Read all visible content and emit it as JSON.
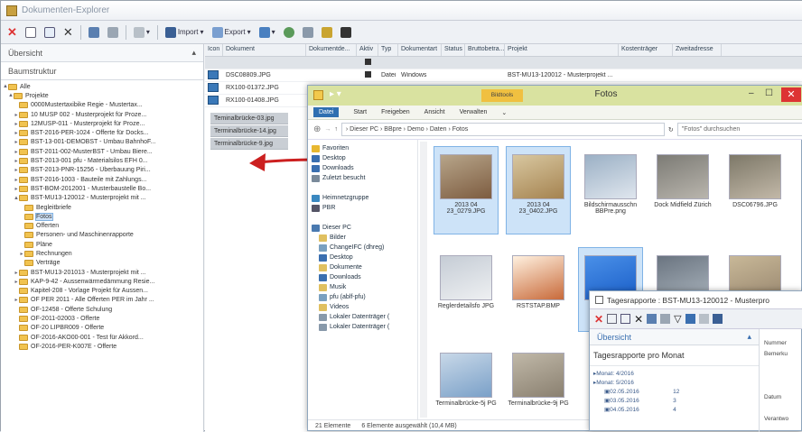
{
  "app": {
    "title": "Dokumenten-Explorer"
  },
  "toolbar": {
    "import_label": "Import",
    "export_label": "Export"
  },
  "left": {
    "overview": "Übersicht",
    "structure": "Baumstruktur",
    "tree": [
      {
        "label": "Alle",
        "ind": 0,
        "tw": "▲"
      },
      {
        "label": "Projekte",
        "ind": 1,
        "tw": "▲"
      },
      {
        "label": "0000Mustertaxibike Regie - Mustertax...",
        "ind": 2,
        "tw": ""
      },
      {
        "label": "10 MUSP 002 - Musterprojekt für Proze...",
        "ind": 2,
        "tw": "▸"
      },
      {
        "label": "12MUSP-011 - Musterprojekt für Proze...",
        "ind": 2,
        "tw": "▸"
      },
      {
        "label": "BST-2016-PER-1024 - Offerte für Docks...",
        "ind": 2,
        "tw": "▸"
      },
      {
        "label": "BST-13-001-DEMOBST - Umbau BahnhoF...",
        "ind": 2,
        "tw": "▸"
      },
      {
        "label": "BST-2011-002-MusterBST - Umbau Biere...",
        "ind": 2,
        "tw": "▸"
      },
      {
        "label": "BST-2013-001 pfu - Materialsilos EFH 0...",
        "ind": 2,
        "tw": "▸"
      },
      {
        "label": "BST-2013-PNR-15256 - Überbauung Piri...",
        "ind": 2,
        "tw": "▸"
      },
      {
        "label": "BST-2016-1003 - Bauteile mit Zahlungs...",
        "ind": 2,
        "tw": "▸"
      },
      {
        "label": "BST-BOM-2012001 - Musterbaustelle Bo...",
        "ind": 2,
        "tw": "▸"
      },
      {
        "label": "BST-MU13-120012 - Musterprojekt mit ...",
        "ind": 2,
        "tw": "▲"
      },
      {
        "label": "Begleitbriefe",
        "ind": 3,
        "tw": ""
      },
      {
        "label": "Fotos",
        "ind": 3,
        "tw": "",
        "sel": true
      },
      {
        "label": "Offerten",
        "ind": 3,
        "tw": ""
      },
      {
        "label": "Personen- und Maschinenrapporte",
        "ind": 3,
        "tw": ""
      },
      {
        "label": "Pläne",
        "ind": 3,
        "tw": ""
      },
      {
        "label": "Rechnungen",
        "ind": 3,
        "tw": "▸"
      },
      {
        "label": "Verträge",
        "ind": 3,
        "tw": ""
      },
      {
        "label": "BST-MU13-201013 - Musterprojekt mit ...",
        "ind": 2,
        "tw": "▸"
      },
      {
        "label": "KAP-9-42 - Aussenwärmedämmung Resie...",
        "ind": 2,
        "tw": "▸"
      },
      {
        "label": "Kapitel-208 - Vorlage Projekt für Aussen...",
        "ind": 2,
        "tw": ""
      },
      {
        "label": "OF PER 2011 - Alle Offerten PER im Jahr ...",
        "ind": 2,
        "tw": "▸"
      },
      {
        "label": "OF-12458 - Offerte Schulung",
        "ind": 2,
        "tw": ""
      },
      {
        "label": "OF-2011-02003 - Offerte",
        "ind": 2,
        "tw": ""
      },
      {
        "label": "OF-20 LIPBR009 - Offerte",
        "ind": 2,
        "tw": ""
      },
      {
        "label": "OF-2016-AKO00-001 - Test für Akkord...",
        "ind": 2,
        "tw": ""
      },
      {
        "label": "OF-2016-PER-K007E - Offerte",
        "ind": 2,
        "tw": ""
      }
    ]
  },
  "grid": {
    "columns": [
      "Icon",
      "Dokument",
      "Dokumentde...",
      "Aktiv",
      "Typ",
      "Dokumentart",
      "Status",
      "Bruttobetra...",
      "Projekt",
      "Kostenträger",
      "Zweitadresse"
    ],
    "rows": [
      {
        "name": "",
        "aktiv": true,
        "typ": "",
        "art": "",
        "projekt": ""
      },
      {
        "name": "DSC08809.JPG",
        "aktiv": true,
        "typ": "Datei",
        "art": "Windows",
        "projekt": "BST-MU13-120012 - Musterprojekt ..."
      },
      {
        "name": "RX100-01372.JPG",
        "aktiv": false,
        "typ": "",
        "art": "",
        "projekt": ""
      },
      {
        "name": "RX100-01408.JPG",
        "aktiv": false,
        "typ": "",
        "art": "",
        "projekt": ""
      }
    ],
    "drag": [
      "Teminalbrücke-03.jpg",
      "Terminalbrücke-14.jpg",
      "Terminalbrücke-9.jpg"
    ]
  },
  "explorer": {
    "context_tab": "Bildtools",
    "title": "Fotos",
    "ribbon": [
      "Datei",
      "Start",
      "Freigeben",
      "Ansicht",
      "Verwalten"
    ],
    "path": [
      "Dieser PC",
      "BBpre",
      "Demo",
      "Daten",
      "Fotos"
    ],
    "search_placeholder": "\"Fotos\" durchsuchen",
    "nav": [
      {
        "label": "Favoriten",
        "color": "#e8b830"
      },
      {
        "label": "Desktop",
        "color": "#3a6fb0"
      },
      {
        "label": "Downloads",
        "color": "#3a6fb0"
      },
      {
        "label": "Zuletzt besucht",
        "color": "#7a8a9a"
      },
      {
        "label": "",
        "color": ""
      },
      {
        "label": "Heimnetzgruppe",
        "color": "#3a88c0"
      },
      {
        "label": "PBR",
        "color": "#556"
      },
      {
        "label": "",
        "color": ""
      },
      {
        "label": "Dieser PC",
        "color": "#4a7ab0"
      },
      {
        "label": "Bilder",
        "color": "#e0c060"
      },
      {
        "label": "ChangeIFC (dhreg)",
        "color": "#7aa0c0"
      },
      {
        "label": "Desktop",
        "color": "#3a6fb0"
      },
      {
        "label": "Dokumente",
        "color": "#e0c060"
      },
      {
        "label": "Downloads",
        "color": "#3a6fb0"
      },
      {
        "label": "Musik",
        "color": "#e0c060"
      },
      {
        "label": "pfu (ablf-pfu)",
        "color": "#7aa0c0"
      },
      {
        "label": "Videos",
        "color": "#e0c060"
      },
      {
        "label": "Lokaler Datenträger (",
        "color": "#8899aa"
      },
      {
        "label": "Lokaler Datenträger (",
        "color": "#8899aa"
      }
    ],
    "files": [
      {
        "label": "2013 04 23_0279.JPG",
        "col": 0,
        "row": 0,
        "sel": true,
        "c1": "#7d5c40",
        "c2": "#b7a58a"
      },
      {
        "label": "2013 04 23_0402.JPG",
        "col": 1,
        "row": 0,
        "sel": true,
        "c1": "#a58350",
        "c2": "#d8c7a0"
      },
      {
        "label": "Bildschirmausschn BBPre.png",
        "col": 2,
        "row": 0,
        "sel": false,
        "c1": "#dfe6ee",
        "c2": "#9bb0c5"
      },
      {
        "label": "Dock Midfield Zürich",
        "col": 3,
        "row": 0,
        "sel": false,
        "c1": "#b9b5ad",
        "c2": "#7c7b75"
      },
      {
        "label": "DSC06796.JPG",
        "col": 4,
        "row": 0,
        "sel": false,
        "c1": "#c2b8a8",
        "c2": "#7d7868"
      },
      {
        "label": "Reglerdetailsfo JPG",
        "col": 0,
        "row": 1,
        "sel": false,
        "c1": "#eef0f2",
        "c2": "#c5ccd5"
      },
      {
        "label": "RSTSTAP.BMP",
        "col": 1,
        "row": 1,
        "sel": false,
        "c1": "#c86a3a",
        "c2": "#fff1e0"
      },
      {
        "label": "",
        "col": 2,
        "row": 1,
        "sel": true,
        "c1": "#1a5ec8",
        "c2": "#4a90e8"
      },
      {
        "label": "",
        "col": 3,
        "row": 1,
        "sel": false,
        "c1": "#a8b2bb",
        "c2": "#6a7480"
      },
      {
        "label": "",
        "col": 4,
        "row": 1,
        "sel": false,
        "c1": "#9a8870",
        "c2": "#c8b898"
      },
      {
        "label": "Terminalbrücke-5j PG",
        "col": 0,
        "row": 2,
        "sel": false,
        "c1": "#7aa0c8",
        "c2": "#c8d8e8"
      },
      {
        "label": "Terminalbrücke-9j PG",
        "col": 1,
        "row": 2,
        "sel": false,
        "c1": "#8a8070",
        "c2": "#c0b8a8"
      }
    ],
    "status_count": "21 Elemente",
    "status_sel": "6 Elemente ausgewählt (10,4 MB)"
  },
  "daily": {
    "title": "Tagesrapporte : BST-MU13-120012 - Musterpro",
    "overview": "Übersicht",
    "heading": "Tagesrapporte pro Monat",
    "rows": [
      {
        "label": "Monat: 4/2016",
        "val": "",
        "ind": 0
      },
      {
        "label": "Monat: 5/2016",
        "val": "",
        "ind": 0
      },
      {
        "label": "02.05.2016",
        "val": "12",
        "ind": 1
      },
      {
        "label": "03.05.2016",
        "val": "3",
        "ind": 1
      },
      {
        "label": "04.05.2016",
        "val": "4",
        "ind": 1
      }
    ],
    "side": [
      "Nummer",
      "Bemerku",
      "",
      "",
      "",
      "Datum",
      "",
      "Verantwo"
    ]
  }
}
